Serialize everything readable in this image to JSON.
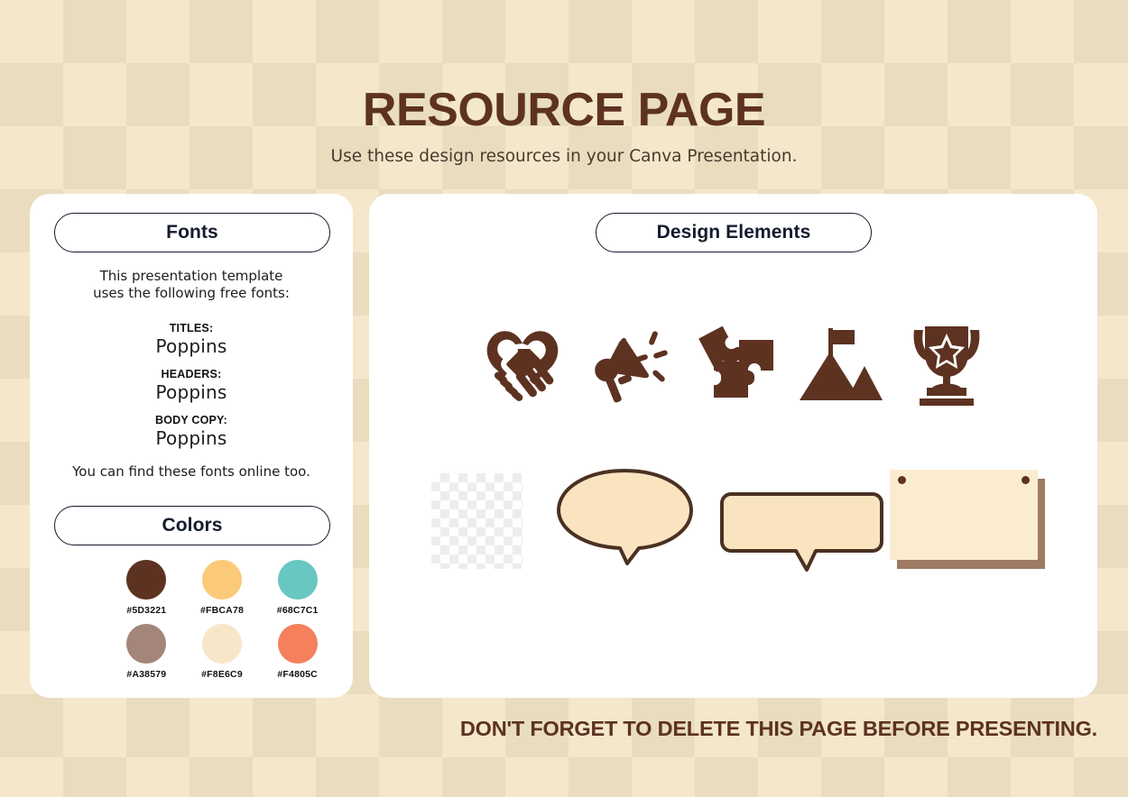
{
  "header": {
    "title": "RESOURCE PAGE",
    "subtitle": "Use these design resources in your Canva Presentation."
  },
  "fonts_panel": {
    "pill_label": "Fonts",
    "intro_line_1": "This presentation template",
    "intro_line_2": "uses the following free fonts:",
    "groups": [
      {
        "label": "TITLES:",
        "value": "Poppins"
      },
      {
        "label": "HEADERS:",
        "value": "Poppins"
      },
      {
        "label": "BODY COPY:",
        "value": "Poppins"
      }
    ],
    "outro": "You can find these fonts online too."
  },
  "colors_panel": {
    "pill_label": "Colors",
    "rows": [
      [
        {
          "hex": "#5D3221",
          "label": "#5D3221"
        },
        {
          "hex": "#FBCA78",
          "label": "#FBCA78"
        },
        {
          "hex": "#68C7C1",
          "label": "#68C7C1"
        }
      ],
      [
        {
          "hex": "#A38579",
          "label": "#A38579"
        },
        {
          "hex": "#F8E6C9",
          "label": "#F8E6C9"
        },
        {
          "hex": "#F4805C",
          "label": "#F4805C"
        }
      ]
    ]
  },
  "design_panel": {
    "pill_label": "Design Elements",
    "icons": [
      {
        "name": "handshake-heart-icon"
      },
      {
        "name": "megaphone-icon"
      },
      {
        "name": "puzzle-pieces-icon"
      },
      {
        "name": "mountain-flag-icon"
      },
      {
        "name": "trophy-star-icon"
      }
    ],
    "shapes": [
      {
        "name": "transparent-placeholder-square"
      },
      {
        "name": "oval-speech-bubble"
      },
      {
        "name": "rounded-rect-speech-bubble"
      },
      {
        "name": "pinned-note-card"
      }
    ]
  },
  "footer": {
    "note": "DON'T FORGET TO DELETE THIS PAGE BEFORE PRESENTING."
  },
  "theme": {
    "brand_brown": "#5D3221",
    "bg_light": "#F4E7CB",
    "bg_dark": "#E9DCBF",
    "panel_bg": "#FFFFFF",
    "note_face": "#FBEBD0",
    "note_shadow": "#9E7A63",
    "bubble_fill": "#FAE4C0",
    "bubble_stroke": "#4A3122"
  }
}
